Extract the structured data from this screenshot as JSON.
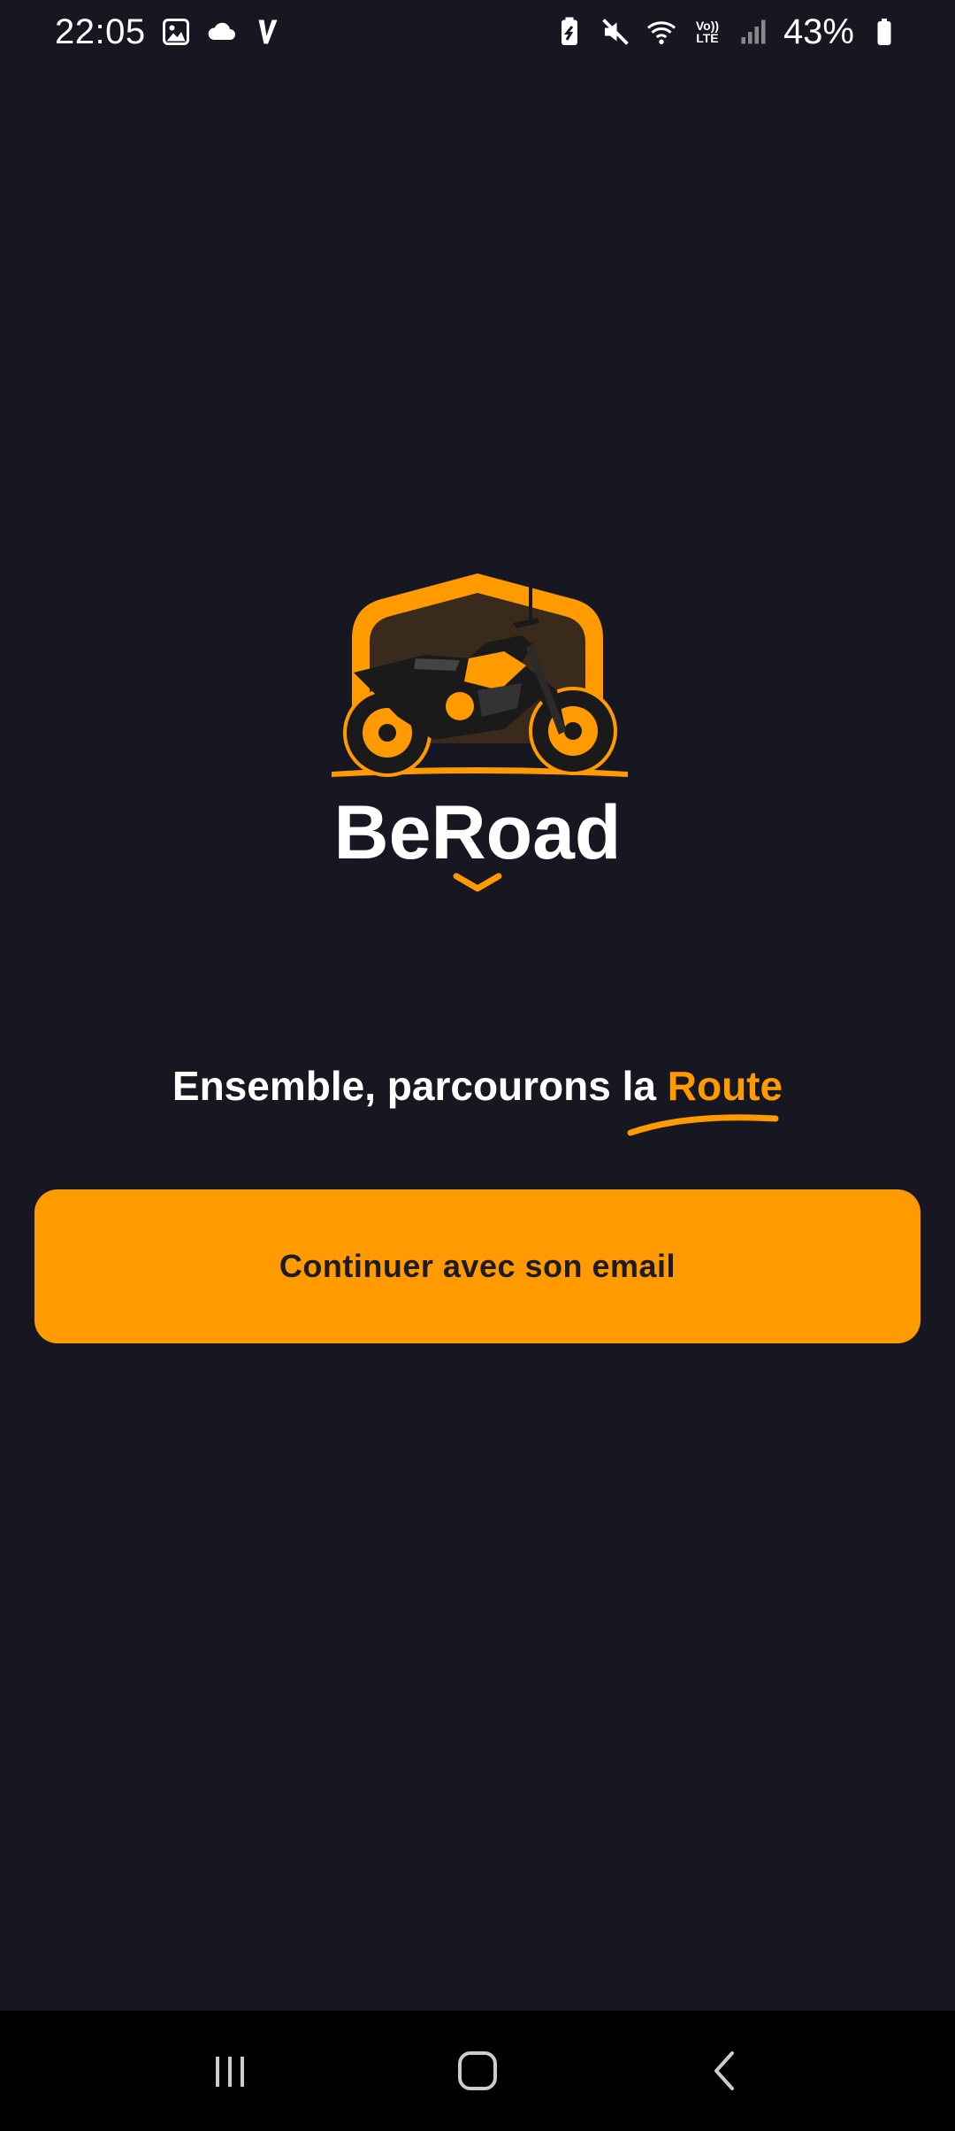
{
  "status_bar": {
    "time": "22:05",
    "battery_percent": "43%",
    "network_label_top": "Vo))",
    "network_label_bottom": "LTE",
    "icons_left": [
      "image-icon",
      "cloud-icon",
      "v-app-icon"
    ],
    "icons_right": [
      "battery-saver-icon",
      "mute-icon",
      "wifi-icon",
      "volte-icon",
      "signal-icon",
      "battery-icon"
    ]
  },
  "brand": {
    "name": "BeRoad",
    "accent_color": "#ff9a00"
  },
  "tagline": {
    "prefix": "Ensemble, parcourons la",
    "accent": "Route"
  },
  "cta": {
    "label": "Continuer avec son email"
  },
  "nav_bar": {
    "buttons": [
      "recents-icon",
      "home-icon",
      "back-icon"
    ]
  }
}
